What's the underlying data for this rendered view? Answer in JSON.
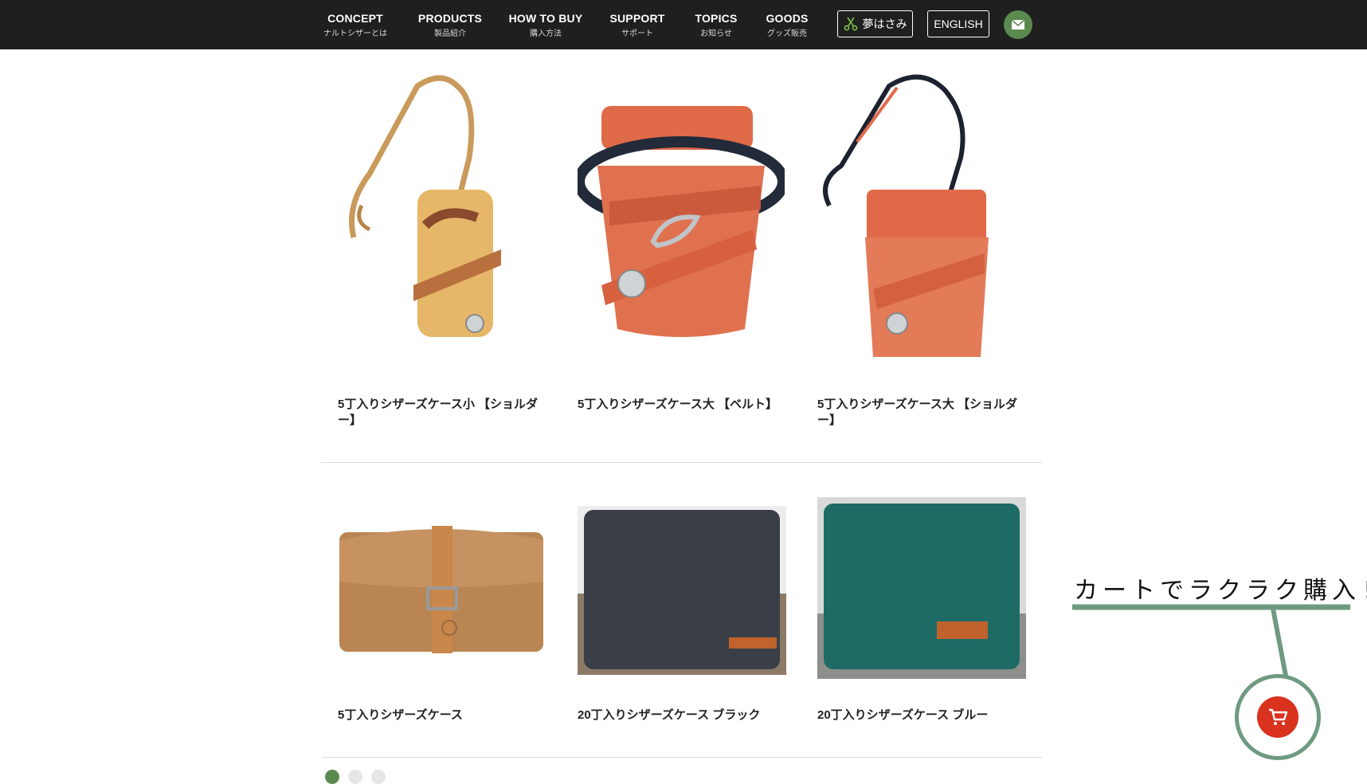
{
  "nav": {
    "items": [
      {
        "en": "CONCEPT",
        "ja": "ナルトシザーとは"
      },
      {
        "en": "PRODUCTS",
        "ja": "製品紹介"
      },
      {
        "en": "HOW TO BUY",
        "ja": "購入方法"
      },
      {
        "en": "SUPPORT",
        "ja": "サポート"
      },
      {
        "en": "TOPICS",
        "ja": "お知らせ"
      },
      {
        "en": "GOODS",
        "ja": "グッズ販売"
      }
    ],
    "yume_label": "夢はさみ",
    "english_label": "ENGLISH"
  },
  "products": [
    {
      "title": "5丁入りシザーズケース小 【ショルダー】"
    },
    {
      "title": "5丁入りシザーズケース大 【ベルト】"
    },
    {
      "title": "5丁入りシザーズケース大 【ショルダー】"
    },
    {
      "title": "5丁入りシザーズケース"
    },
    {
      "title": "20丁入りシザーズケース ブラック"
    },
    {
      "title": "20丁入りシザーズケース ブルー"
    }
  ],
  "promo": {
    "text": "カートでラクラク購入!"
  },
  "colors": {
    "nav_bg": "#1f1f1f",
    "brand_green": "#5b8a4f",
    "cart_red": "#d9321f",
    "promo_green": "#6f9a82"
  }
}
